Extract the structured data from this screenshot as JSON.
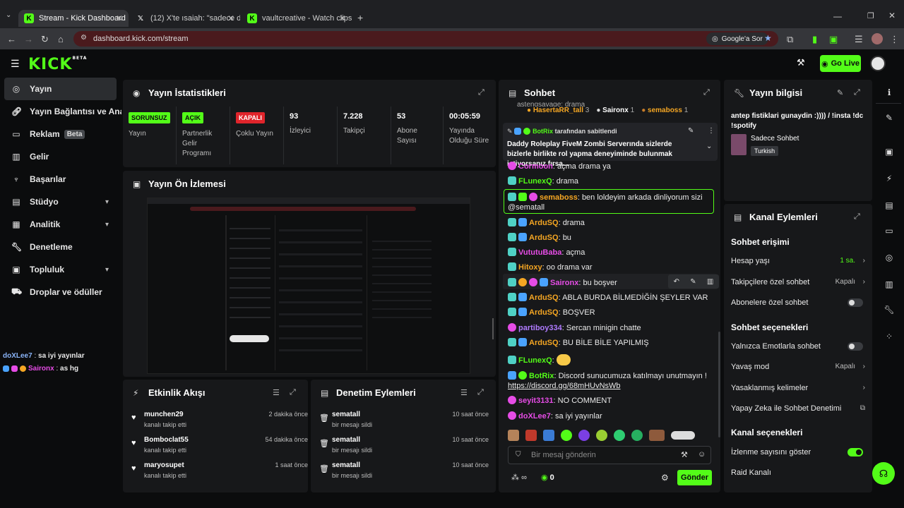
{
  "browser": {
    "tabs": [
      {
        "label": "Stream - Kick Dashboard",
        "icon": "kick-icon",
        "active": true
      },
      {
        "label": "(12) X'te ısaiah: \"sadece ddrpyic",
        "icon": "x-icon",
        "active": false
      },
      {
        "label": "vaultcreative - Watch clips on K",
        "icon": "kick-icon",
        "active": false
      }
    ],
    "url": "dashboard.kick.com/stream",
    "google_btn": "Google'a Sor"
  },
  "header": {
    "logo": "KICK",
    "logo_sup": "BETA",
    "go_live": "Go Live"
  },
  "sidebar": {
    "items": [
      {
        "label": "Yayın",
        "icon": "stream-icon"
      },
      {
        "label": "Yayın Bağlantısı ve Anahtarı",
        "icon": "link-icon"
      },
      {
        "label": "Reklam",
        "icon": "ad-icon",
        "badge": "Beta"
      },
      {
        "label": "Gelir",
        "icon": "revenue-icon"
      },
      {
        "label": "Başarılar",
        "icon": "trophy-icon"
      },
      {
        "label": "Stüdyo",
        "icon": "studio-icon"
      },
      {
        "label": "Analitik",
        "icon": "analytics-icon"
      },
      {
        "label": "Denetleme",
        "icon": "wrench-icon"
      },
      {
        "label": "Topluluk",
        "icon": "community-icon"
      },
      {
        "label": "Droplar ve ödüller",
        "icon": "gift-icon"
      }
    ],
    "mini_chat": [
      {
        "user": "doXLee7",
        "text": "sa iyi yayınlar"
      },
      {
        "user": "Saironx",
        "text": "as hg"
      }
    ]
  },
  "stats": {
    "title": "Yayın İstatistikleri",
    "cells": [
      {
        "value": "SORUNSUZ",
        "label": "Yayın",
        "color": "#53fc18"
      },
      {
        "value": "AÇIK",
        "label": "Partnerlik Gelir Programı",
        "color": "#53fc18"
      },
      {
        "value": "KAPALI",
        "label": "Çoklu Yayın",
        "color": "#e0242b"
      },
      {
        "value": "93",
        "label": "İzleyici"
      },
      {
        "value": "7.228",
        "label": "Takipçi"
      },
      {
        "value": "53",
        "label": "Abone Sayısı"
      },
      {
        "value": "00:05:59",
        "label": "Yayında Olduğu Süre"
      }
    ]
  },
  "preview": {
    "title": "Yayın Ön İzlemesi"
  },
  "activity": {
    "title": "Etkinlik Akışı",
    "items": [
      {
        "name": "munchen29",
        "sub": "kanalı takip etti",
        "time": "2 dakika önce"
      },
      {
        "name": "Bomboclat55",
        "sub": "kanalı takip etti",
        "time": "54 dakika önce"
      },
      {
        "name": "maryosupet",
        "sub": "kanalı takip etti",
        "time": "1 saat önce"
      }
    ]
  },
  "moderation": {
    "title": "Denetim Eylemleri",
    "items": [
      {
        "name": "sematall",
        "sub": "bir mesajı sildi",
        "time": "10 saat önce"
      },
      {
        "name": "sematall",
        "sub": "bir mesajı sildi",
        "time": "10 saat önce"
      },
      {
        "name": "sematall",
        "sub": "bir mesajı sildi",
        "time": "10 saat önce"
      }
    ]
  },
  "chat": {
    "title": "Sohbet",
    "top_user_partial": "astengsavage: drama",
    "top_gifters": [
      {
        "name": "HasertaRR_tall",
        "count": "3",
        "color": "#f5a623"
      },
      {
        "name": "Saironx",
        "count": "1",
        "color": "#ffffff"
      },
      {
        "name": "semaboss",
        "count": "1",
        "color": "#f5a623"
      }
    ],
    "pinned": {
      "by": "BotRix",
      "by_suffix": "tarafından sabitlendi",
      "text": "Daddy Roleplay FiveM Zombi Serverında sizlerde bizlerle birlikte rol yapma deneyiminde bulunmak istiyorsanız fırsa..."
    },
    "messages": [
      {
        "user": "Cormoon",
        "text": "açma drama ya",
        "color": "#e64ce6"
      },
      {
        "user": "FLunexQ",
        "text": "drama",
        "color": "#53fc18"
      },
      {
        "user": "semaboss",
        "text": "ben loldeyim arkada dinliyorum sizi",
        "text2": "@sematall",
        "color": "#f5a623",
        "highlight": true
      },
      {
        "user": "ArduSQ",
        "text": "drama",
        "color": "#f5a623"
      },
      {
        "user": "ArduSQ",
        "text": "bu",
        "color": "#f5a623"
      },
      {
        "user": "VututuBaba",
        "text": "açma",
        "color": "#e64ce6"
      },
      {
        "user": "Hitoxy",
        "text": "oo drama var",
        "color": "#f5a623"
      },
      {
        "user": "Saironx",
        "text": "bu boşver",
        "color": "#e64ce6"
      },
      {
        "user": "ArduSQ",
        "text": "ABLA BURDA BİLMEDİĞİN ŞEYLER VAR",
        "color": "#f5a623"
      },
      {
        "user": "ArduSQ",
        "text": "BOŞVER",
        "color": "#f5a623"
      },
      {
        "user": "partiboy334",
        "text": "Sercan minigin chatte",
        "color": "#b07bff"
      },
      {
        "user": "ArduSQ",
        "text": "BU BİLE BİLE YAPILMIŞ",
        "color": "#f5a623"
      },
      {
        "user": "FLunexQ",
        "text": "",
        "color": "#53fc18"
      },
      {
        "user": "BotRix",
        "text": "Discord sunucumuza katılmayı unutmayın !",
        "text2": "https://discord.gg/68mHUvNsWb",
        "color": "#53fc18"
      },
      {
        "user": "seyit3131",
        "text": "NO COMMENT",
        "color": "#e64ce6"
      },
      {
        "user": "doXLee7",
        "text": "sa iyi yayınlar",
        "color": "#e64ce6"
      }
    ],
    "input_placeholder": "Bir mesaj gönderin",
    "viewer_count": "0",
    "infinity": "∞",
    "send": "Gönder"
  },
  "stream_info": {
    "title": "Yayın bilgisi",
    "stream_title": "antep fistiklari gunaydin :)))) / !insta !dc !spotify",
    "category": "Sadece Sohbet",
    "tag": "Turkish"
  },
  "channel_actions": {
    "title": "Kanal Eylemleri",
    "sections": [
      {
        "heading": "Sohbet erişimi",
        "rows": [
          {
            "label": "Hesap yaşı",
            "value": "1 sa.",
            "kind": "link-green"
          },
          {
            "label": "Takipçilere özel sohbet",
            "value": "Kapalı",
            "kind": "link"
          },
          {
            "label": "Abonelere özel sohbet",
            "kind": "toggle",
            "on": false
          }
        ]
      },
      {
        "heading": "Sohbet seçenekleri",
        "rows": [
          {
            "label": "Yalnızca Emotlarla sohbet",
            "kind": "toggle",
            "on": false
          },
          {
            "label": "Yavaş mod",
            "value": "Kapalı",
            "kind": "link"
          },
          {
            "label": "Yasaklanmış kelimeler",
            "kind": "link"
          },
          {
            "label": "Yapay Zeka ile Sohbet Denetimi",
            "kind": "external"
          }
        ]
      },
      {
        "heading": "Kanal seçenekleri",
        "rows": [
          {
            "label": "İzlenme sayısını göster",
            "kind": "toggle",
            "on": true
          },
          {
            "label": "Raid Kanalı",
            "kind": "none"
          }
        ]
      }
    ]
  },
  "colors": {
    "accent": "#53fc18",
    "danger": "#e0242b",
    "panel": "#17181a",
    "bg": "#0b0c0d"
  }
}
